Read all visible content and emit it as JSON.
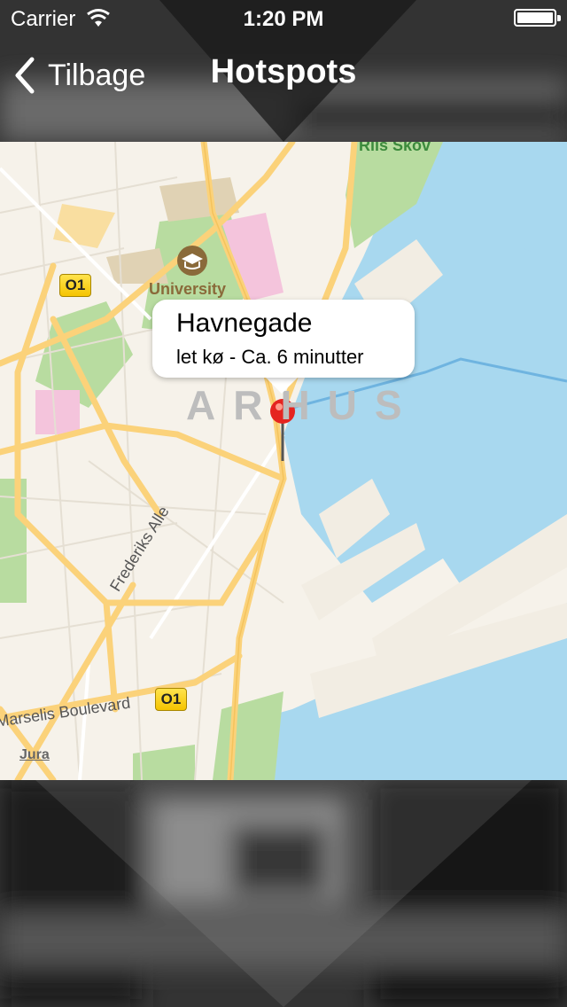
{
  "status_bar": {
    "carrier": "Carrier",
    "time": "1:20 PM"
  },
  "nav_bar": {
    "back_label": "Tilbage",
    "title": "Hotspots"
  },
  "map": {
    "labels": {
      "riis_skov": "Riis Skov",
      "university": "University",
      "city": "ARHUS",
      "frederiks_alle": "Frederiks Alle",
      "marselis_boulevard": "Marselis Boulevard",
      "legal": "Jura",
      "route_badge_1": "O1",
      "route_badge_2": "O1"
    },
    "callout": {
      "title": "Havnegade",
      "subtitle": "let kø - Ca. 6 minutter"
    },
    "colors": {
      "water": "#a8d8ef",
      "land": "#f6f2ea",
      "park": "#b8dca0",
      "road": "#fbd27a",
      "pin": "#e52420"
    }
  }
}
